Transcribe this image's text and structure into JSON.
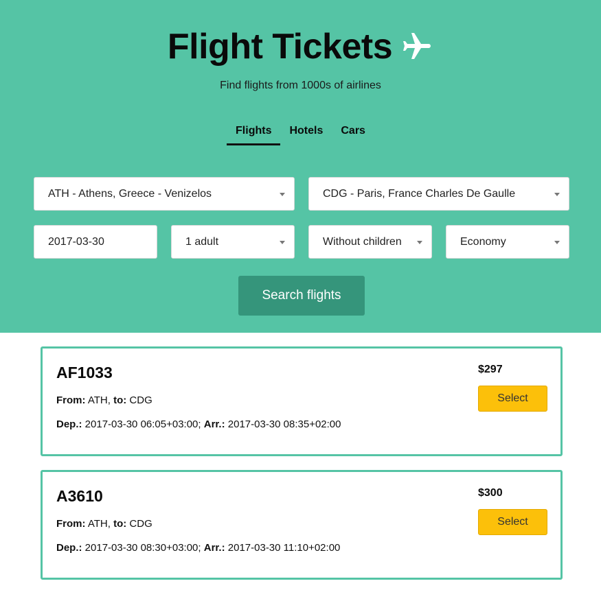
{
  "header": {
    "title": "Flight Tickets",
    "subtitle": "Find flights from 1000s of airlines"
  },
  "tabs": [
    {
      "label": "Flights",
      "active": true
    },
    {
      "label": "Hotels",
      "active": false
    },
    {
      "label": "Cars",
      "active": false
    }
  ],
  "search": {
    "from": "ATH - Athens, Greece - Venizelos",
    "to": "CDG - Paris, France Charles De Gaulle",
    "date": "2017-03-30",
    "adults": "1 adult",
    "children": "Without children",
    "cabin": "Economy",
    "button_label": "Search flights"
  },
  "results": [
    {
      "code": "AF1033",
      "from_label": "From:",
      "from": "ATH",
      "to_label": "to:",
      "to": "CDG",
      "dep_label": "Dep.:",
      "dep": "2017-03-30 06:05+03:00;",
      "arr_label": "Arr.:",
      "arr": "2017-03-30 08:35+02:00",
      "price": "$297",
      "select_label": "Select"
    },
    {
      "code": "A3610",
      "from_label": "From:",
      "from": "ATH",
      "to_label": "to:",
      "to": "CDG",
      "dep_label": "Dep.:",
      "dep": "2017-03-30 08:30+03:00;",
      "arr_label": "Arr.:",
      "arr": "2017-03-30 11:10+02:00",
      "price": "$300",
      "select_label": "Select"
    }
  ],
  "colors": {
    "hero_bg": "#55c4a5",
    "search_button": "#35957b",
    "select_button": "#fcc00a",
    "card_border": "#55c4a5"
  },
  "icons": {
    "title_icon": "airplane-icon",
    "dropdown_icon": "chevron-down-icon"
  }
}
